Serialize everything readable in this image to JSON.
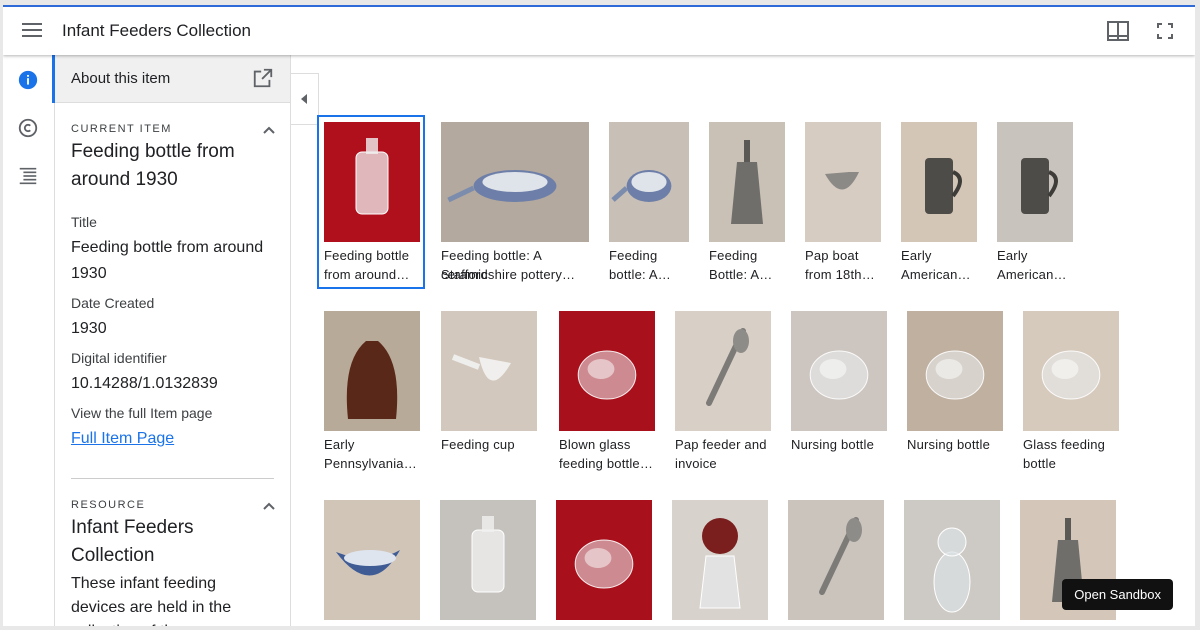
{
  "topbar": {
    "title": "Infant Feeders Collection"
  },
  "panel": {
    "header_label": "About this item",
    "current": {
      "section_label": "CURRENT ITEM",
      "title": "Feeding bottle from around 1930",
      "fields": [
        {
          "label": "Title",
          "value": "Feeding bottle from around 1930"
        },
        {
          "label": "Date Created",
          "value": "1930"
        },
        {
          "label": "Digital identifier",
          "value": "10.14288/1.0132839"
        }
      ],
      "full_page_label": "View the full Item page",
      "full_page_link": "Full Item Page"
    },
    "resource": {
      "section_label": "RESOURCE",
      "title": "Infant Feeders Collection",
      "description": "These infant feeding devices are held in the collection of the"
    }
  },
  "gallery": {
    "rows": [
      [
        {
          "cap1": "Feeding bottle",
          "cap2": "from around…",
          "bg": "#b0101c",
          "obj": "bottle"
        },
        {
          "cap1": "Feeding bottle: A ceramic",
          "cap2": "Staffordshire pottery…",
          "bg": "#b3a99f",
          "obj": "pap"
        },
        {
          "cap1": "Feeding",
          "cap2": "bottle: A…",
          "bg": "#c8bfb6",
          "obj": "pap"
        },
        {
          "cap1": "Feeding",
          "cap2": "Bottle: A…",
          "bg": "#c9c0b6",
          "obj": "pewter"
        },
        {
          "cap1": "Pap boat",
          "cap2": "from 18th…",
          "bg": "#d6ccc2",
          "obj": "boat"
        },
        {
          "cap1": "Early",
          "cap2": "American…",
          "bg": "#d4c6b7",
          "obj": "jug"
        },
        {
          "cap1": "Early",
          "cap2": "American…",
          "bg": "#c9c3bd",
          "obj": "jug"
        }
      ],
      [
        {
          "cap1": "Early",
          "cap2": "Pennsylvania…",
          "bg": "#b8aa98",
          "obj": "brown"
        },
        {
          "cap1": "Feeding cup",
          "cap2": "",
          "bg": "#d3c8bd",
          "obj": "cup"
        },
        {
          "cap1": "Blown glass",
          "cap2": "feeding bottle…",
          "bg": "#a8101c",
          "obj": "glass"
        },
        {
          "cap1": "Pap feeder and",
          "cap2": "invoice",
          "bg": "#d8cfc6",
          "obj": "spoon"
        },
        {
          "cap1": "Nursing bottle",
          "cap2": "",
          "bg": "#cdc6c0",
          "obj": "glass"
        },
        {
          "cap1": "Nursing bottle",
          "cap2": "",
          "bg": "#bfb0a0",
          "obj": "glass"
        },
        {
          "cap1": "Glass feeding",
          "cap2": "bottle",
          "bg": "#d6cabd",
          "obj": "glass"
        }
      ],
      [
        {
          "cap1": "",
          "cap2": "",
          "bg": "#d1c5b8",
          "obj": "bluecup"
        },
        {
          "cap1": "",
          "cap2": "",
          "bg": "#c5c2be",
          "obj": "bottle"
        },
        {
          "cap1": "",
          "cap2": "",
          "bg": "#a8101c",
          "obj": "glass"
        },
        {
          "cap1": "",
          "cap2": "",
          "bg": "#d8d2cc",
          "obj": "bulb"
        },
        {
          "cap1": "",
          "cap2": "",
          "bg": "#cbc4bd",
          "obj": "spoon"
        },
        {
          "cap1": "",
          "cap2": "",
          "bg": "#cdc9c4",
          "obj": "figure"
        },
        {
          "cap1": "",
          "cap2": "",
          "bg": "#d4c7ba",
          "obj": "pewter"
        }
      ]
    ]
  },
  "tooltip": {
    "label": "Open Sandbox"
  }
}
